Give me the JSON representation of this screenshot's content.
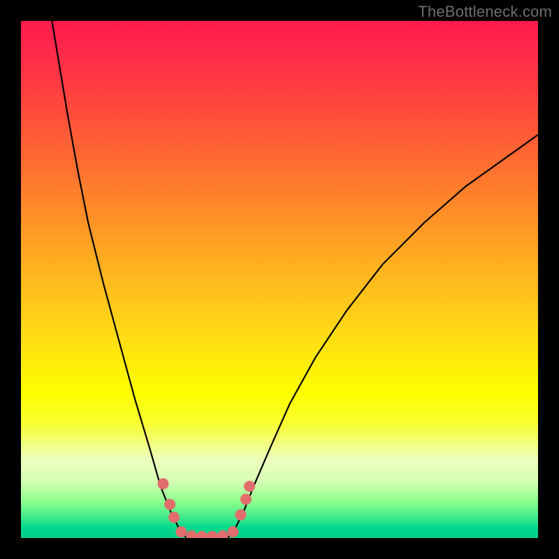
{
  "watermark": "TheBottleneck.com",
  "chart_data": {
    "type": "line",
    "title": "",
    "xlabel": "",
    "ylabel": "",
    "xlim": [
      0,
      100
    ],
    "ylim": [
      0,
      100
    ],
    "gradient_stops": [
      {
        "pct": 0,
        "color": "#ff1a4d"
      },
      {
        "pct": 25,
        "color": "#ff6533"
      },
      {
        "pct": 50,
        "color": "#ffb31f"
      },
      {
        "pct": 72,
        "color": "#ffff00"
      },
      {
        "pct": 90,
        "color": "#d6ffb3"
      },
      {
        "pct": 100,
        "color": "#00cc88"
      }
    ],
    "series": [
      {
        "name": "curve-left",
        "x": [
          6,
          7.5,
          9,
          11,
          13,
          16,
          19,
          22,
          25,
          27,
          29,
          30.5,
          32
        ],
        "values": [
          100,
          91,
          82,
          71,
          61,
          49,
          38,
          27,
          17,
          10,
          5,
          2,
          0
        ]
      },
      {
        "name": "curve-right",
        "x": [
          40,
          41.5,
          43,
          45,
          48,
          52,
          57,
          63,
          70,
          78,
          86,
          93,
          100
        ],
        "values": [
          0,
          2,
          5,
          10,
          17,
          26,
          35,
          44,
          53,
          61,
          68,
          73,
          78
        ]
      }
    ],
    "valley_flat_x": [
      32,
      40
    ],
    "markers": {
      "name": "highlight-dots",
      "color": "#e26d6d",
      "points": [
        {
          "x": 27.5,
          "y": 10.5
        },
        {
          "x": 28.8,
          "y": 6.5
        },
        {
          "x": 29.6,
          "y": 4.0
        },
        {
          "x": 31.0,
          "y": 1.2
        },
        {
          "x": 33.0,
          "y": 0.4
        },
        {
          "x": 35.0,
          "y": 0.3
        },
        {
          "x": 37.0,
          "y": 0.3
        },
        {
          "x": 39.0,
          "y": 0.4
        },
        {
          "x": 41.0,
          "y": 1.2
        },
        {
          "x": 42.5,
          "y": 4.5
        },
        {
          "x": 43.5,
          "y": 7.5
        },
        {
          "x": 44.2,
          "y": 10.0
        }
      ]
    }
  }
}
